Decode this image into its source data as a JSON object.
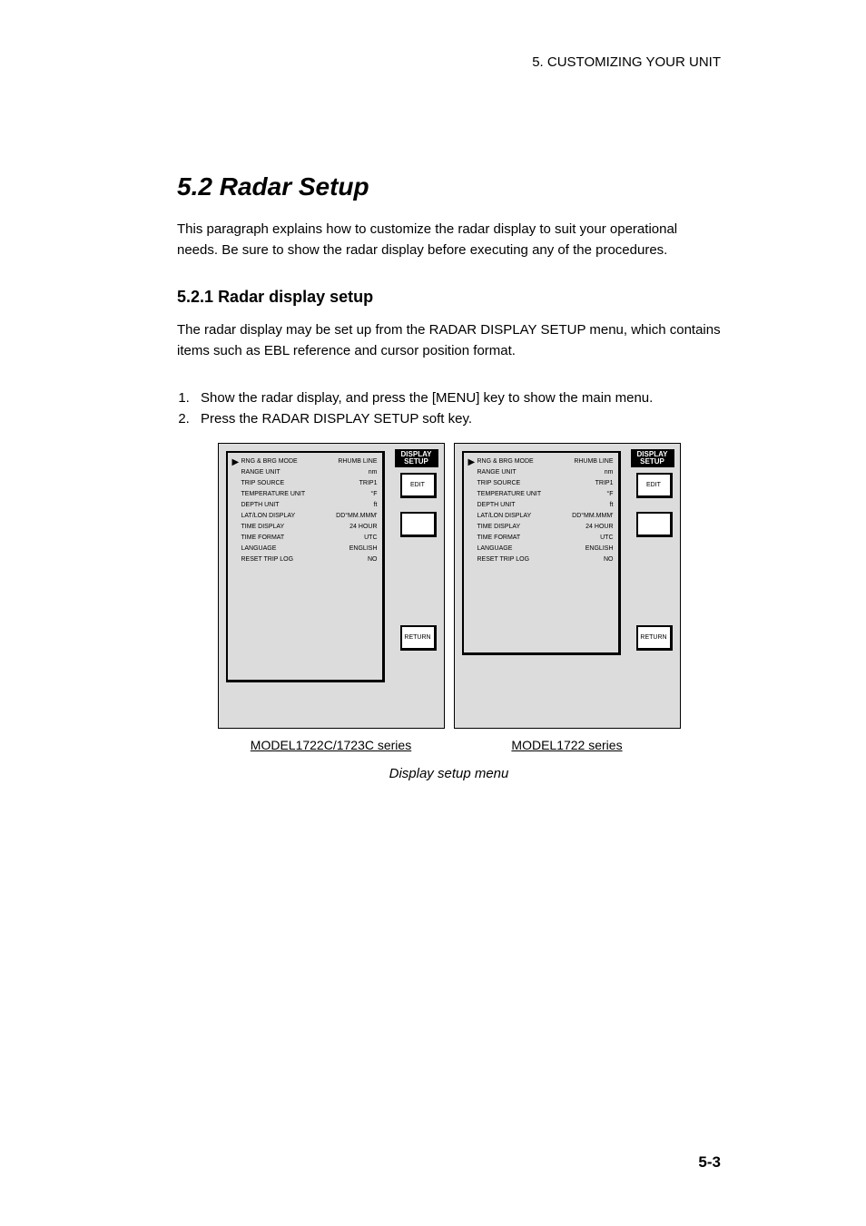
{
  "header": {
    "section": "5. CUSTOMIZING YOUR UNIT"
  },
  "section": {
    "number": "5.2",
    "title": "Radar Setup"
  },
  "intro_text": "This paragraph explains how to customize the radar display to suit your operational needs. Be sure to show the radar display before executing any of the procedures.",
  "subsection": {
    "number": "5.2.1",
    "title": "Radar display setup"
  },
  "subsection_text": "The radar display may be set up from the RADAR DISPLAY SETUP menu, which contains items such as EBL reference and cursor position format.",
  "steps": [
    "Show the radar display, and press the [MENU] key to show the main menu.",
    "Press the RADAR DISPLAY SETUP soft key."
  ],
  "panel_left": {
    "title": "DISPLAY SETUP",
    "arrow": "▶",
    "menu": [
      {
        "label": "RNG & BRG MODE",
        "value": "RHUMB LINE"
      },
      {
        "label": "RANGE UNIT",
        "value": "nm"
      },
      {
        "label": "TRIP SOURCE",
        "value": "TRIP1"
      },
      {
        "label": "TEMPERATURE UNIT",
        "value": "°F"
      },
      {
        "label": "DEPTH UNIT",
        "value": "ft"
      },
      {
        "label": "LAT/LON DISPLAY",
        "value": "DD°MM.MMM'"
      },
      {
        "label": "TIME DISPLAY",
        "value": "24 HOUR"
      },
      {
        "label": "TIME FORMAT",
        "value": "UTC"
      },
      {
        "label": "LANGUAGE",
        "value": "ENGLISH"
      },
      {
        "label": "RESET TRIP LOG",
        "value": "NO"
      }
    ],
    "softkeys": [
      "EDIT",
      "",
      "RETURN"
    ],
    "caption": "MODEL1722C/1723C series"
  },
  "panel_right": {
    "title": "DISPLAY SETUP",
    "arrow": "▶",
    "menu": [
      {
        "label": "RNG & BRG MODE",
        "value": "RHUMB LINE"
      },
      {
        "label": "RANGE UNIT",
        "value": "nm"
      },
      {
        "label": "TRIP SOURCE",
        "value": "TRIP1"
      },
      {
        "label": "TEMPERATURE UNIT",
        "value": "°F"
      },
      {
        "label": "DEPTH UNIT",
        "value": "ft"
      },
      {
        "label": "LAT/LON DISPLAY",
        "value": "DD°MM.MMM'"
      },
      {
        "label": "TIME DISPLAY",
        "value": "24 HOUR"
      },
      {
        "label": "TIME FORMAT",
        "value": "UTC"
      },
      {
        "label": "LANGUAGE",
        "value": "ENGLISH"
      },
      {
        "label": "RESET TRIP LOG",
        "value": "NO"
      }
    ],
    "softkeys": [
      "EDIT",
      "",
      "RETURN"
    ],
    "caption": "MODEL1722 series"
  },
  "figure_caption": "Display setup menu",
  "page_number": "5-3"
}
